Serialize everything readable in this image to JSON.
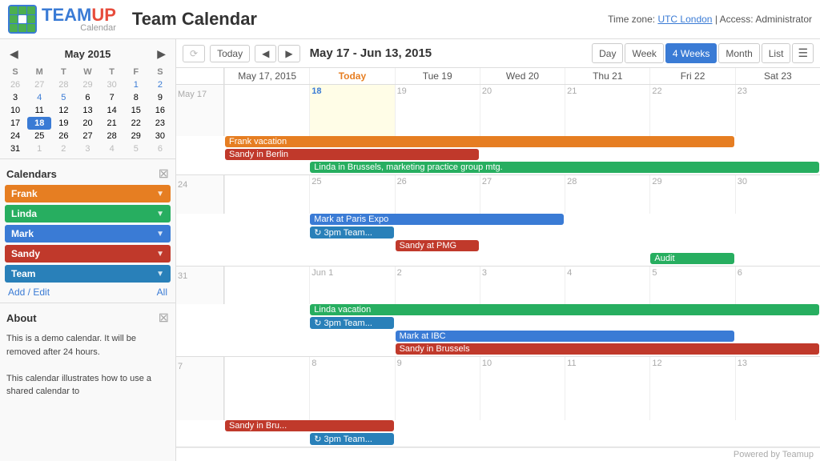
{
  "header": {
    "title": "Team Calendar",
    "timezone_label": "Time zone:",
    "timezone_value": "UTC London",
    "access_label": "Access:",
    "access_value": "Administrator"
  },
  "toolbar": {
    "refresh_label": "⟳",
    "today_label": "Today",
    "prev_label": "◀",
    "next_label": "▶",
    "range": "May 17 - Jun 13, 2015",
    "day_label": "Day",
    "week_label": "Week",
    "four_weeks_label": "4 Weeks",
    "month_label": "Month",
    "list_label": "List"
  },
  "mini_cal": {
    "title": "May 2015",
    "days_header": [
      "S",
      "M",
      "T",
      "W",
      "T",
      "F",
      "S"
    ],
    "weeks": [
      [
        {
          "d": "26",
          "other": true
        },
        {
          "d": "27",
          "other": true
        },
        {
          "d": "28",
          "other": true
        },
        {
          "d": "29",
          "other": true
        },
        {
          "d": "30",
          "other": true
        },
        {
          "d": "1",
          "blue": true
        },
        {
          "d": "2",
          "blue": true
        }
      ],
      [
        {
          "d": "3"
        },
        {
          "d": "4",
          "blue": true
        },
        {
          "d": "5",
          "blue": true
        },
        {
          "d": "6"
        },
        {
          "d": "7"
        },
        {
          "d": "8"
        },
        {
          "d": "9"
        }
      ],
      [
        {
          "d": "10"
        },
        {
          "d": "11"
        },
        {
          "d": "12"
        },
        {
          "d": "13"
        },
        {
          "d": "14"
        },
        {
          "d": "15"
        },
        {
          "d": "16"
        }
      ],
      [
        {
          "d": "17"
        },
        {
          "d": "18",
          "today": true
        },
        {
          "d": "19"
        },
        {
          "d": "20"
        },
        {
          "d": "21"
        },
        {
          "d": "22"
        },
        {
          "d": "23"
        }
      ],
      [
        {
          "d": "24"
        },
        {
          "d": "25"
        },
        {
          "d": "26"
        },
        {
          "d": "27"
        },
        {
          "d": "28"
        },
        {
          "d": "29"
        },
        {
          "d": "30"
        }
      ],
      [
        {
          "d": "31"
        },
        {
          "d": "1",
          "other": true
        },
        {
          "d": "2",
          "other": true
        },
        {
          "d": "3",
          "other": true
        },
        {
          "d": "4",
          "other": true
        },
        {
          "d": "5",
          "other": true
        },
        {
          "d": "6",
          "other": true
        }
      ]
    ]
  },
  "calendars": {
    "title": "Calendars",
    "items": [
      {
        "name": "Frank",
        "color": "#e67e22"
      },
      {
        "name": "Linda",
        "color": "#27ae60"
      },
      {
        "name": "Mark",
        "color": "#3a7bd5"
      },
      {
        "name": "Sandy",
        "color": "#c0392b"
      },
      {
        "name": "Team",
        "color": "#2980b9"
      }
    ],
    "add_edit": "Add / Edit",
    "all": "All"
  },
  "about": {
    "title": "About",
    "text": "This is a demo calendar. It will be removed after 24 hours.\n\nThis calendar illustrates how to use a shared calendar to"
  },
  "calendar": {
    "day_headers": [
      "May 17, 2015",
      "Today",
      "Tue 19",
      "Wed 20",
      "Thu 21",
      "Fri 22",
      "Sat 23"
    ],
    "weeks": [
      {
        "label": "",
        "days": [
          "May 17",
          "18",
          "19",
          "20",
          "21",
          "22",
          "23"
        ],
        "today_col": 1,
        "events_rows": [
          {
            "col_start": 0,
            "col_span": 6,
            "label": "Frank vacation",
            "color": "#e67e22",
            "indent": false
          },
          {
            "col_start": 0,
            "col_span": 3,
            "label": "Sandy in Berlin",
            "color": "#c0392b",
            "indent": false
          },
          {
            "col_start": 1,
            "col_span": 6,
            "label": "Linda in Brussels, marketing practice group mtg.",
            "color": "#27ae60",
            "indent": true
          }
        ]
      },
      {
        "label": "",
        "days": [
          "24",
          "25",
          "26",
          "27",
          "28",
          "29",
          "30"
        ],
        "today_col": -1,
        "events_rows": [
          {
            "col_start": 1,
            "col_span": 3,
            "label": "Mark at Paris Expo",
            "color": "#3a7bd5",
            "indent": false
          },
          {
            "col_start": 1,
            "col_span": 1,
            "label": "3pm Team...",
            "color": "#2980b9",
            "indent": false,
            "repeat": true
          },
          {
            "col_start": 2,
            "col_span": 1,
            "label": "Sandy at PMG",
            "color": "#c0392b",
            "indent": false
          },
          {
            "col_start": 5,
            "col_span": 1,
            "label": "Audit",
            "color": "#27ae60",
            "indent": false
          }
        ]
      },
      {
        "label": "",
        "days": [
          "31",
          "Jun 1",
          "2",
          "3",
          "4",
          "5",
          "6"
        ],
        "today_col": -1,
        "events_rows": [
          {
            "col_start": 1,
            "col_span": 6,
            "label": "Linda vacation",
            "color": "#27ae60",
            "indent": false
          },
          {
            "col_start": 1,
            "col_span": 1,
            "label": "3pm Team...",
            "color": "#2980b9",
            "indent": false,
            "repeat": true
          },
          {
            "col_start": 2,
            "col_span": 4,
            "label": "Mark at IBC",
            "color": "#3a7bd5",
            "indent": false
          },
          {
            "col_start": 2,
            "col_span": 5,
            "label": "Sandy in Brussels",
            "color": "#c0392b",
            "indent": true
          }
        ]
      },
      {
        "label": "",
        "days": [
          "7",
          "8",
          "9",
          "10",
          "11",
          "12",
          "13"
        ],
        "today_col": -1,
        "events_rows": [
          {
            "col_start": 0,
            "col_span": 2,
            "label": "Sandy in Bru...",
            "color": "#c0392b",
            "indent": false
          },
          {
            "col_start": 1,
            "col_span": 1,
            "label": "3pm Team...",
            "color": "#2980b9",
            "indent": false,
            "repeat": true
          }
        ]
      }
    ]
  },
  "footer": {
    "powered_by": "Powered by Teamup"
  }
}
